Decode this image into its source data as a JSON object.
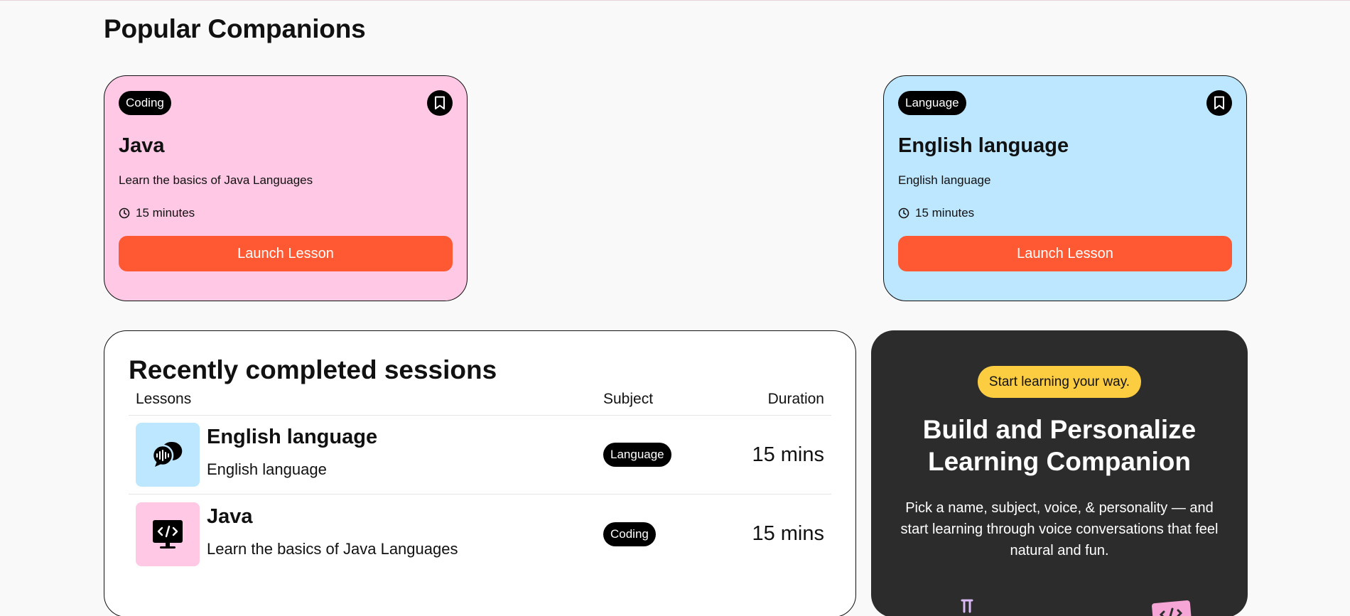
{
  "popular": {
    "title": "Popular Companions",
    "cards": [
      {
        "subject": "Coding",
        "name": "Java",
        "description": "Learn the basics of Java Languages",
        "duration": "15 minutes",
        "button": "Launch Lesson",
        "color": "#ffc8e4"
      },
      {
        "subject": "Language",
        "name": "English language",
        "description": "English language",
        "duration": "15 minutes",
        "button": "Launch Lesson",
        "color": "#bde7ff"
      }
    ]
  },
  "sessions": {
    "title": "Recently completed sessions",
    "headers": {
      "lessons": "Lessons",
      "subject": "Subject",
      "duration": "Duration"
    },
    "rows": [
      {
        "icon": "language-icon",
        "icon_bg": "#bde7ff",
        "name": "English language",
        "description": "English language",
        "subject": "Language",
        "duration": "15 mins"
      },
      {
        "icon": "coding-icon",
        "icon_bg": "#ffc8e4",
        "name": "Java",
        "description": "Learn the basics of Java Languages",
        "subject": "Coding",
        "duration": "15 mins"
      }
    ]
  },
  "cta": {
    "pill": "Start learning your way.",
    "title": "Build and Personalize Learning Companion",
    "text": "Pick a name, subject, voice, & personality — and start learning through voice conversations that feel natural and fun."
  },
  "colors": {
    "accent": "#fe5933",
    "pill": "#fccc41",
    "dark_panel": "#2c2c2c"
  }
}
